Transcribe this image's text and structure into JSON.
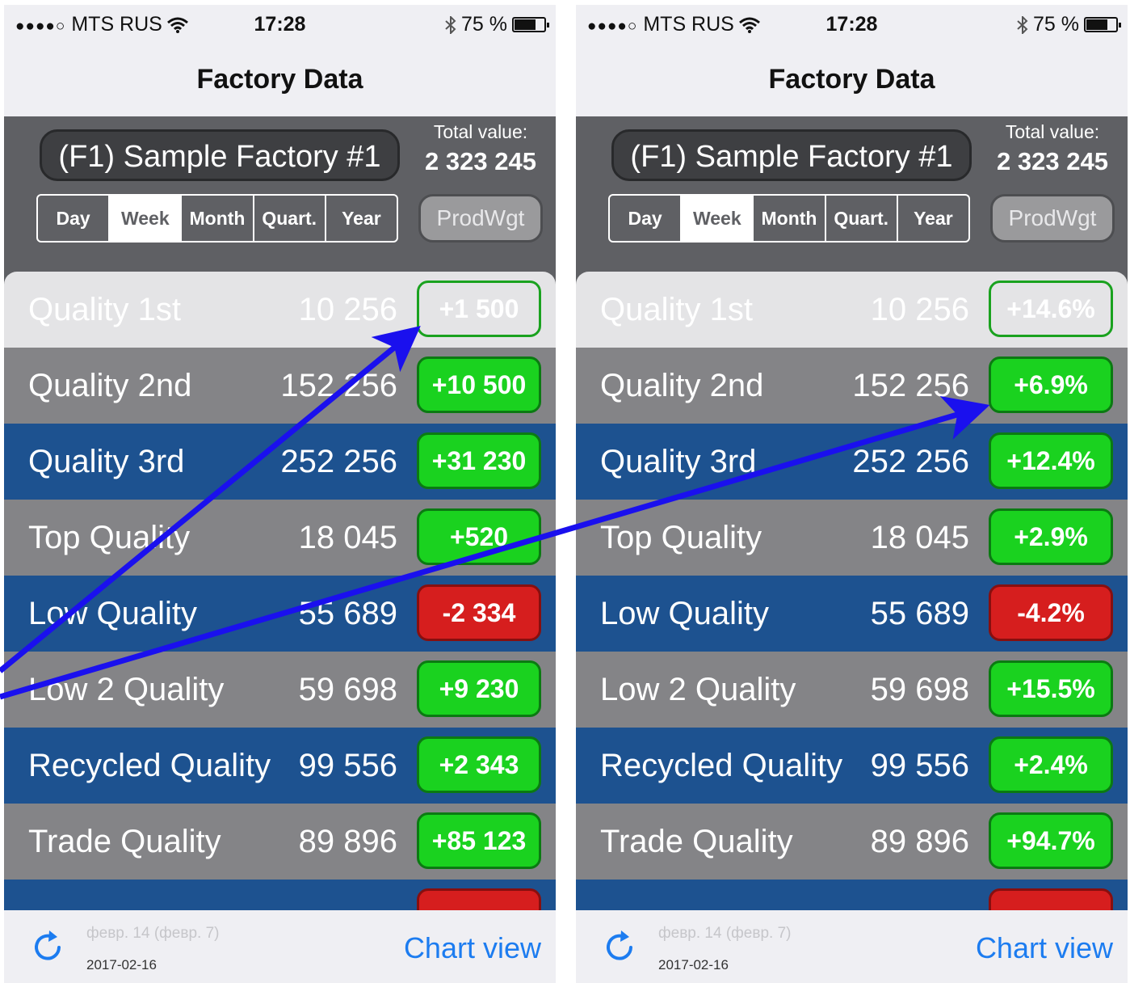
{
  "colors": {
    "badge_positive": "#1ad21f",
    "badge_negative": "#d61e1e",
    "row_gray": "#848487",
    "row_blue": "#1d5290",
    "header_bg": "#5f6064",
    "chart_view_link": "#1c7cf0",
    "arrow": "#1a10ee"
  },
  "left": {
    "status": {
      "carrier": "MTS RUS",
      "time": "17:28",
      "battery": "75 %",
      "battery_level": 0.75
    },
    "nav_title": "Factory Data",
    "factory_name": "(F1) Sample Factory #1",
    "total_label": "Total value:",
    "total_value": "2 323 245",
    "periods": [
      "Day",
      "Week",
      "Month",
      "Quart.",
      "Year"
    ],
    "selected_period": "Week",
    "prodwgt_label": "ProdWgt",
    "rows": [
      {
        "name": "Quality 1st",
        "value": "10 256",
        "delta": "+1 500",
        "sign": "pos",
        "style": "first"
      },
      {
        "name": "Quality 2nd",
        "value": "152 256",
        "delta": "+10 500",
        "sign": "pos",
        "style": "gray"
      },
      {
        "name": "Quality 3rd",
        "value": "252 256",
        "delta": "+31 230",
        "sign": "pos",
        "style": "blue"
      },
      {
        "name": "Top Quality",
        "value": "18 045",
        "delta": "+520",
        "sign": "pos",
        "style": "gray"
      },
      {
        "name": "Low Quality",
        "value": "55 689",
        "delta": "-2 334",
        "sign": "neg",
        "style": "blue"
      },
      {
        "name": "Low 2 Quality",
        "value": "59 698",
        "delta": "+9 230",
        "sign": "pos",
        "style": "gray"
      },
      {
        "name": "Recycled Quality",
        "value": "99 556",
        "delta": "+2 343",
        "sign": "pos",
        "style": "blue"
      },
      {
        "name": "Trade Quality",
        "value": "89 896",
        "delta": "+85 123",
        "sign": "pos",
        "style": "gray"
      },
      {
        "name": "",
        "value": "",
        "delta": "",
        "sign": "neg",
        "style": "blue"
      }
    ],
    "footer": {
      "date_faded": "февр. 14 (февр. 7)",
      "date": "2017-02-16",
      "chart_view": "Chart view"
    }
  },
  "right": {
    "status": {
      "carrier": "MTS RUS",
      "time": "17:28",
      "battery": "75 %",
      "battery_level": 0.75
    },
    "nav_title": "Factory Data",
    "factory_name": "(F1) Sample Factory #1",
    "total_label": "Total value:",
    "total_value": "2 323 245",
    "periods": [
      "Day",
      "Week",
      "Month",
      "Quart.",
      "Year"
    ],
    "selected_period": "Week",
    "prodwgt_label": "ProdWgt",
    "rows": [
      {
        "name": "Quality 1st",
        "value": "10 256",
        "delta": "+14.6%",
        "sign": "pos",
        "style": "first"
      },
      {
        "name": "Quality 2nd",
        "value": "152 256",
        "delta": "+6.9%",
        "sign": "pos",
        "style": "gray"
      },
      {
        "name": "Quality 3rd",
        "value": "252 256",
        "delta": "+12.4%",
        "sign": "pos",
        "style": "blue"
      },
      {
        "name": "Top Quality",
        "value": "18 045",
        "delta": "+2.9%",
        "sign": "pos",
        "style": "gray"
      },
      {
        "name": "Low Quality",
        "value": "55 689",
        "delta": "-4.2%",
        "sign": "neg",
        "style": "blue"
      },
      {
        "name": "Low 2 Quality",
        "value": "59 698",
        "delta": "+15.5%",
        "sign": "pos",
        "style": "gray"
      },
      {
        "name": "Recycled Quality",
        "value": "99 556",
        "delta": "+2.4%",
        "sign": "pos",
        "style": "blue"
      },
      {
        "name": "Trade Quality",
        "value": "89 896",
        "delta": "+94.7%",
        "sign": "pos",
        "style": "gray"
      },
      {
        "name": "",
        "value": "",
        "delta": "",
        "sign": "neg",
        "style": "blue"
      }
    ],
    "footer": {
      "date_faded": "февр. 14 (февр. 7)",
      "date": "2017-02-16",
      "chart_view": "Chart view"
    }
  }
}
